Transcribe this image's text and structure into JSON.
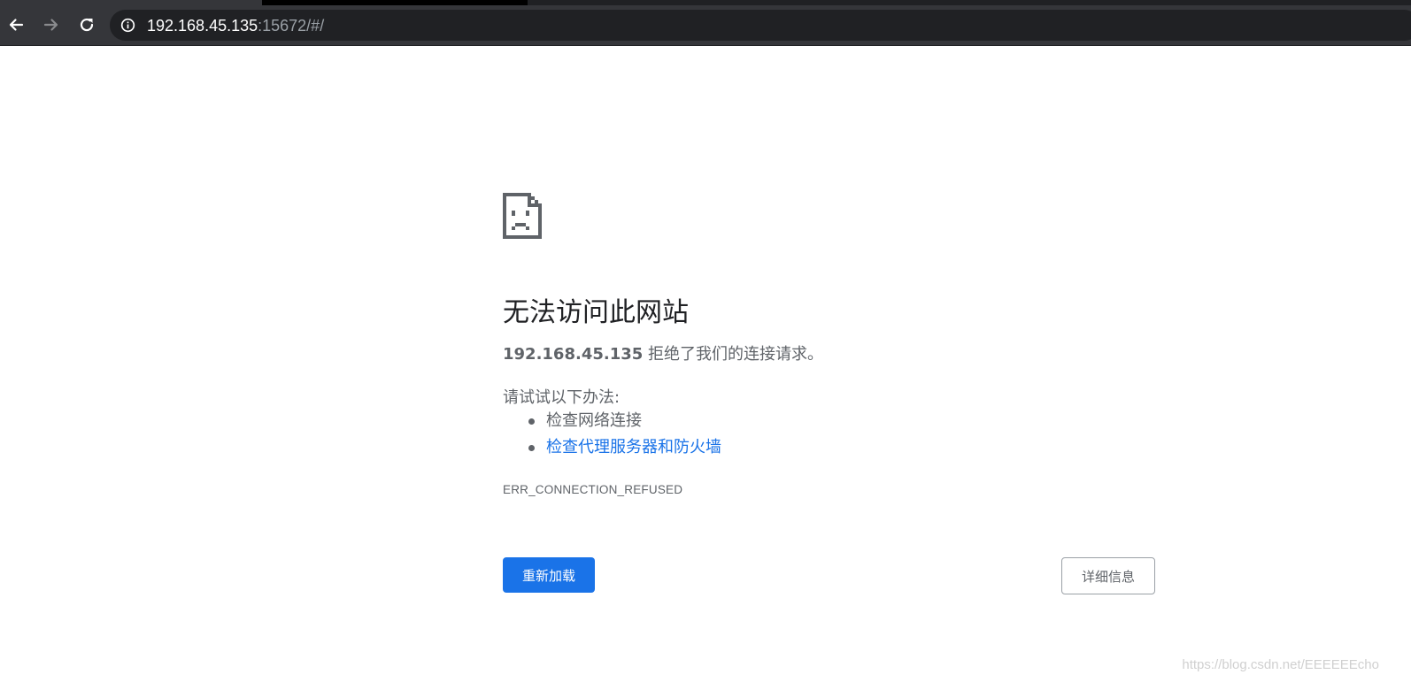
{
  "browser": {
    "url_host": "192.168.45.135",
    "url_rest": ":15672/#/",
    "icons": {
      "back": "back-arrow-icon",
      "forward": "forward-arrow-icon",
      "reload": "reload-icon",
      "site_info": "info-icon"
    }
  },
  "error_page": {
    "icon": "sad-document-icon",
    "heading": "无法访问此网站",
    "summary_host": "192.168.45.135",
    "summary_text": " 拒绝了我们的连接请求。",
    "suggest_title": "请试试以下办法:",
    "suggestions": [
      {
        "label": "检查网络连接",
        "is_link": false
      },
      {
        "label": "检查代理服务器和防火墙",
        "is_link": true
      }
    ],
    "error_code": "ERR_CONNECTION_REFUSED",
    "reload_label": "重新加载",
    "details_label": "详细信息"
  },
  "watermark": "https://blog.csdn.net/EEEEEEcho",
  "colors": {
    "primary_button": "#1a73e8",
    "link": "#1a73e8",
    "body_text": "#5f6368",
    "heading_text": "#202124",
    "chrome_toolbar": "#35363a",
    "omnibox": "#202124"
  }
}
